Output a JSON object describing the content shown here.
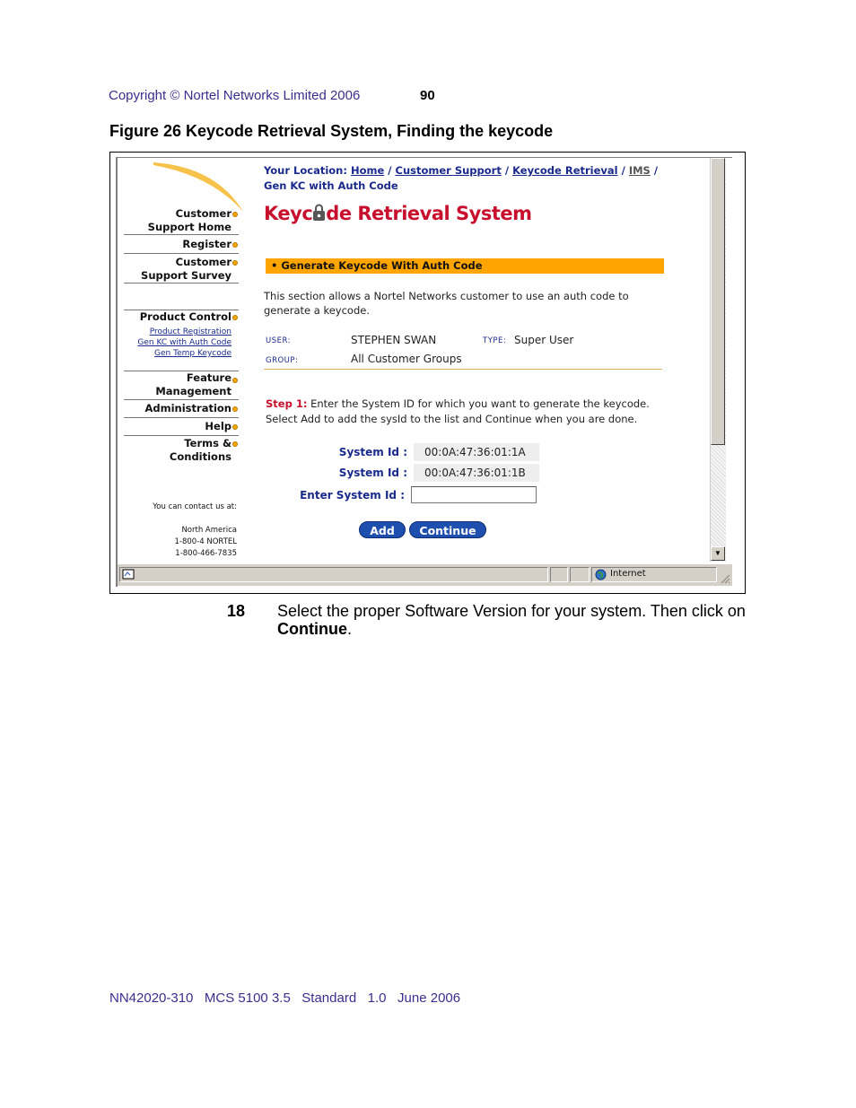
{
  "header": {
    "copyright": "Copyright © Nortel Networks Limited 2006",
    "page_number": "90"
  },
  "figure": {
    "caption": "Figure 26  Keycode Retrieval System, Finding the keycode"
  },
  "browser": {
    "location": {
      "prefix": "Your Location:",
      "crumbs": [
        "Home",
        "Customer Support",
        "Keycode Retrieval",
        "IMS"
      ],
      "current": "Gen KC with Auth Code"
    },
    "site_title": {
      "before": "Keyc",
      "after": "de Retrieval System",
      "icon": "lock-icon"
    },
    "sidebar": {
      "items": [
        {
          "label": "Customer Support Home"
        },
        {
          "label": "Register"
        },
        {
          "label": "Customer Support Survey"
        },
        {
          "label": "Product Control"
        },
        {
          "label": "Feature Management"
        },
        {
          "label": "Administration"
        },
        {
          "label": "Help"
        },
        {
          "label": "Terms & Conditions"
        }
      ],
      "sublinks": [
        "Product Registration",
        "Gen KC with Auth Code",
        "Gen Temp Keycode"
      ],
      "contact_intro": "You can contact us at:",
      "contact_region": "North America",
      "contact_phone1": "1-800-4 NORTEL",
      "contact_phone2": "1-800-466-7835"
    },
    "banner": "• Generate Keycode With Auth Code",
    "description": "This section allows a Nortel Networks customer to use an auth code to generate a keycode.",
    "user": {
      "user_label": "USER:",
      "user_value": "STEPHEN SWAN",
      "type_label": "TYPE:",
      "type_value": "Super User",
      "group_label": "GROUP:",
      "group_value": "All Customer Groups"
    },
    "step": {
      "label": "Step 1:",
      "text": " Enter the System ID for which you want to generate the keycode. Select Add to add the sysId to the list and Continue when you are done."
    },
    "system_ids": {
      "label": "System Id :",
      "values": [
        "00:0A:47:36:01:1A",
        "00:0A:47:36:01:1B"
      ],
      "enter_label": "Enter System Id :",
      "enter_value": ""
    },
    "buttons": {
      "add": "Add",
      "continue": "Continue"
    },
    "statusbar": {
      "zone": "Internet"
    },
    "colors": {
      "banner": "#ffa500",
      "title": "#c8102e",
      "link": "#1a2a8c",
      "button": "#1f4fae"
    }
  },
  "instruction": {
    "number": "18",
    "text_before": "Select the proper Software Version for your system. Then click on ",
    "bold": "Continue",
    "text_after": "."
  },
  "footer": {
    "text": "NN42020-310   MCS 5100 3.5   Standard   1.0   June 2006"
  }
}
